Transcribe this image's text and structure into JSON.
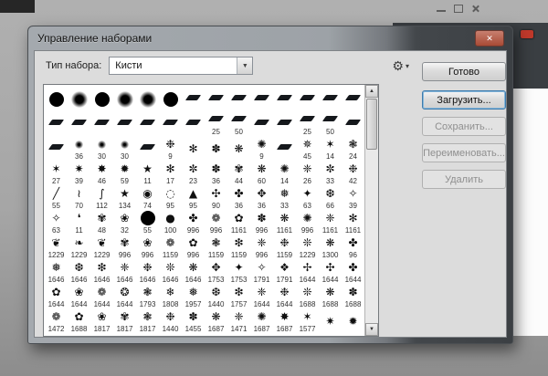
{
  "window": {
    "title": "Управление наборами",
    "close_icon": "✕"
  },
  "toolbar": {
    "type_label": "Тип набора:",
    "type_value": "Кисти",
    "dropdown_arrow": "▼",
    "gear_icon": "⚙",
    "menu_arrow": "▾"
  },
  "buttons": {
    "done": "Готово",
    "load": "Загрузить...",
    "save": "Сохранить...",
    "rename": "Переименовать...",
    "delete": "Удалить"
  },
  "scrollbar": {
    "up": "▲",
    "down": "▼"
  },
  "colors": {
    "dark_panel": "#3a3e42",
    "red_badge": "#c0392b",
    "focus_blue": "#3d7bad",
    "disabled_text": "#8f8f8f"
  },
  "grid": {
    "rows": [
      {
        "icons": [
          "@hard",
          "@soft",
          "@hard",
          "@soft",
          "@soft",
          "@hard",
          "@tip",
          "@tip",
          "@tip",
          "@tip",
          "@tip",
          "@tip",
          "@tip",
          "@tip"
        ],
        "sizes": [
          "",
          "",
          "",
          "",
          "",
          "",
          "",
          "",
          "",
          "",
          "",
          "",
          "",
          ""
        ]
      },
      {
        "icons": [
          "@tip",
          "@tip",
          "@tip",
          "@tip",
          "@tip",
          "@tip",
          "@tip",
          "@tip",
          "@tip",
          "@tip",
          "@tip",
          "@tip",
          "@tip",
          "@tip"
        ],
        "sizes": [
          "",
          "",
          "",
          "",
          "",
          "",
          "",
          "25",
          "50",
          "",
          "",
          "25",
          "50",
          ""
        ]
      },
      {
        "icons": [
          "@tip",
          "@dot",
          "@dot",
          "@dot",
          "@tip",
          "❉",
          "✻",
          "✽",
          "❋",
          "✺",
          "@tip",
          "✵",
          "✶",
          "❃"
        ],
        "sizes": [
          "",
          "36",
          "30",
          "30",
          "",
          "9",
          "",
          "",
          "",
          "9",
          "",
          "45",
          "14",
          "24"
        ]
      },
      {
        "icons": [
          "✶",
          "✷",
          "✸",
          "✹",
          "★",
          "✻",
          "✼",
          "✽",
          "✾",
          "❋",
          "✺",
          "❈",
          "✼",
          "❉"
        ],
        "sizes": [
          "27",
          "39",
          "46",
          "59",
          "11",
          "17",
          "23",
          "36",
          "44",
          "60",
          "14",
          "26",
          "33",
          "42"
        ]
      },
      {
        "icons": [
          "╱",
          "≀",
          "∫",
          "★",
          "◉",
          "◌",
          "▲",
          "✣",
          "✤",
          "✥",
          "❅",
          "✦",
          "❆",
          "✧"
        ],
        "sizes": [
          "55",
          "70",
          "112",
          "134",
          "74",
          "95",
          "95",
          "90",
          "36",
          "36",
          "33",
          "63",
          "66",
          "39"
        ]
      },
      {
        "icons": [
          "✧",
          "❛",
          "✾",
          "❀",
          "@hard",
          "●",
          "✤",
          "❁",
          "✿",
          "✽",
          "❋",
          "✺",
          "❈",
          "✻"
        ],
        "sizes": [
          "63",
          "11",
          "48",
          "32",
          "55",
          "100",
          "996",
          "996",
          "1161",
          "996",
          "1161",
          "996",
          "1161",
          "1161"
        ]
      },
      {
        "icons": [
          "❦",
          "❧",
          "❦",
          "✾",
          "❀",
          "❁",
          "✿",
          "❃",
          "❇",
          "❈",
          "❉",
          "❊",
          "❋",
          "✤"
        ],
        "sizes": [
          "1229",
          "1229",
          "1229",
          "996",
          "996",
          "1159",
          "996",
          "1159",
          "1159",
          "996",
          "1159",
          "1229",
          "1300",
          "96"
        ]
      },
      {
        "icons": [
          "❅",
          "❆",
          "❇",
          "❈",
          "❉",
          "❊",
          "❋",
          "✥",
          "✦",
          "✧",
          "❖",
          "✢",
          "✣",
          "✤"
        ],
        "sizes": [
          "1646",
          "1646",
          "1646",
          "1646",
          "1646",
          "1646",
          "1646",
          "1753",
          "1753",
          "1791",
          "1791",
          "1644",
          "1644",
          "1644"
        ]
      },
      {
        "icons": [
          "✿",
          "❀",
          "❁",
          "❂",
          "❃",
          "❄",
          "❅",
          "❆",
          "❇",
          "❈",
          "❉",
          "❊",
          "❋",
          "✽"
        ],
        "sizes": [
          "1644",
          "1644",
          "1644",
          "1644",
          "1793",
          "1808",
          "1957",
          "1440",
          "1757",
          "1644",
          "1644",
          "1688",
          "1688",
          "1688"
        ]
      },
      {
        "icons": [
          "❁",
          "✿",
          "❀",
          "✾",
          "❃",
          "❉",
          "✽",
          "❋",
          "❈",
          "✺",
          "✸",
          "✶",
          "✷",
          "✹"
        ],
        "sizes": [
          "1472",
          "1688",
          "1817",
          "1817",
          "1817",
          "1440",
          "1455",
          "1687",
          "1471",
          "1687",
          "1687",
          "1577",
          "",
          ""
        ]
      }
    ]
  }
}
